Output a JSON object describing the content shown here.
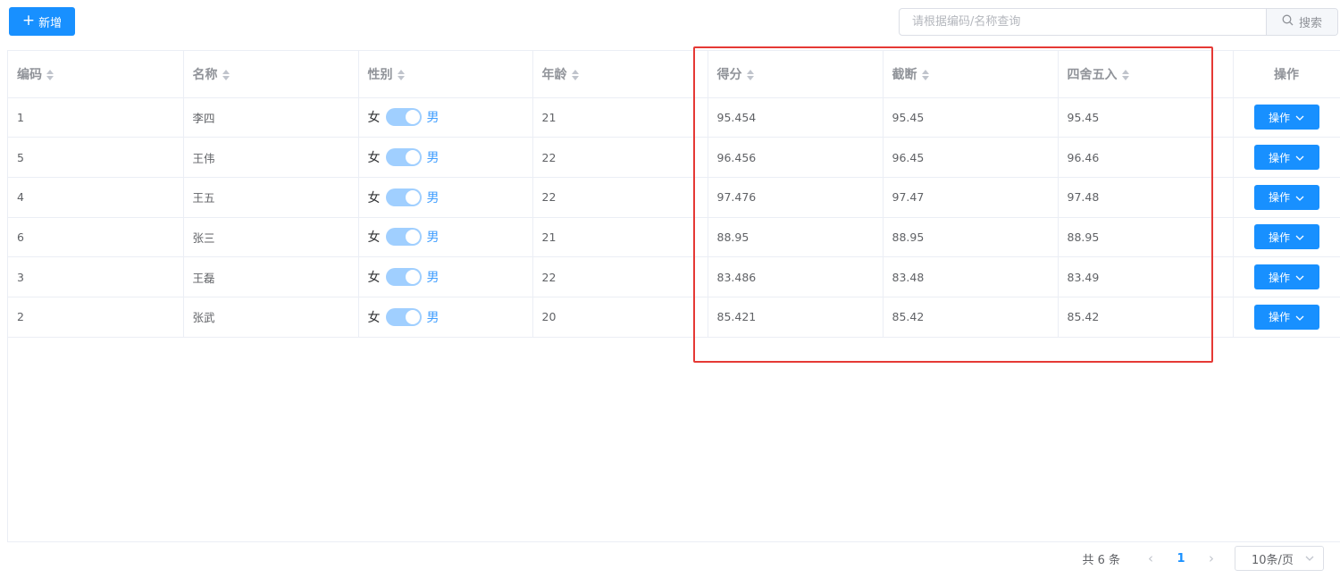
{
  "toolbar": {
    "add_label": "新增",
    "search_placeholder": "请根据编码/名称查询",
    "search_button_label": "搜索"
  },
  "table": {
    "headers": {
      "code": "编码",
      "name": "名称",
      "gender": "性别",
      "age": "年龄",
      "score": "得分",
      "truncated": "截断",
      "rounded": "四舍五入",
      "actions": "操作"
    },
    "gender_off_label": "女",
    "gender_on_label": "男",
    "action_button_label": "操作",
    "rows": [
      {
        "code": "1",
        "name": "李四",
        "age": "21",
        "score": "95.454",
        "truncated": "95.45",
        "rounded": "95.45",
        "gender_male": true
      },
      {
        "code": "5",
        "name": "王伟",
        "age": "22",
        "score": "96.456",
        "truncated": "96.45",
        "rounded": "96.46",
        "gender_male": true
      },
      {
        "code": "4",
        "name": "王五",
        "age": "22",
        "score": "97.476",
        "truncated": "97.47",
        "rounded": "97.48",
        "gender_male": true
      },
      {
        "code": "6",
        "name": "张三",
        "age": "21",
        "score": "88.95",
        "truncated": "88.95",
        "rounded": "88.95",
        "gender_male": true
      },
      {
        "code": "3",
        "name": "王磊",
        "age": "22",
        "score": "83.486",
        "truncated": "83.48",
        "rounded": "83.49",
        "gender_male": true
      },
      {
        "code": "2",
        "name": "张武",
        "age": "20",
        "score": "85.421",
        "truncated": "85.42",
        "rounded": "85.42",
        "gender_male": true
      }
    ]
  },
  "pagination": {
    "total_label": "共 6 条",
    "current_page": "1",
    "page_size_label": "10条/页"
  },
  "colors": {
    "primary": "#1890ff",
    "switch_on": "#a0cfff",
    "highlight_border": "#e53935"
  }
}
